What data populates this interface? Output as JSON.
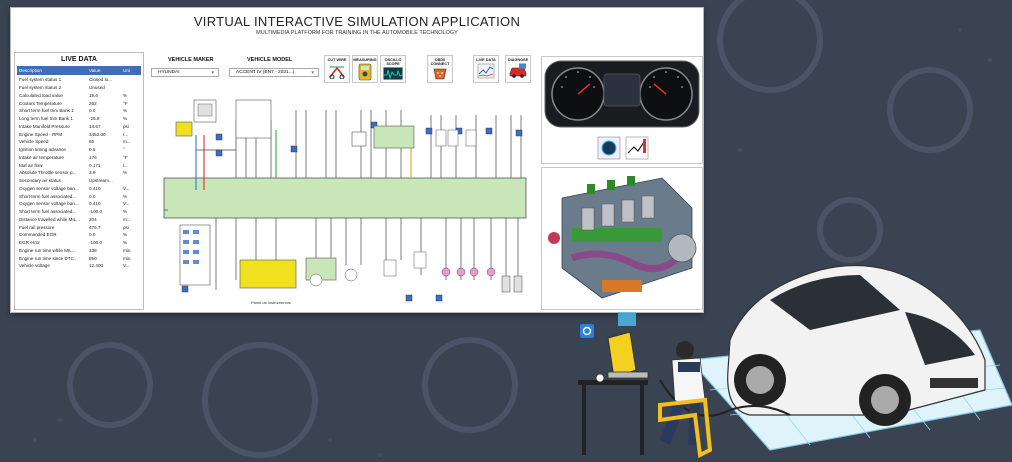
{
  "app": {
    "title": "VIRTUAL INTERACTIVE SIMULATION APPLICATION",
    "subtitle": "MULTIMEDIA PLATFORM FOR TRAINING IN THE AUTOMOBILE TECHNOLOGY"
  },
  "live_data": {
    "title": "LIVE DATA",
    "columns": [
      "Description",
      "Value",
      "Uni"
    ],
    "rows": [
      [
        "Fuel system status 1",
        "Closed lo...",
        ""
      ],
      [
        "Fuel system status 2",
        "Unused",
        ""
      ],
      [
        "Calculated load value",
        "19.6",
        "%"
      ],
      [
        "Coolant Temperature",
        "262",
        "°F"
      ],
      [
        "Short term fuel trim Bank 1",
        "0.0",
        "%"
      ],
      [
        "Long term fuel trim Bank 1",
        "-25.9",
        "%"
      ],
      [
        "Intake Manifold Pressure",
        "14.57",
        "psi"
      ],
      [
        "Engine Speed - RPM",
        "3452.00",
        "r..."
      ],
      [
        "Vehicle Speed",
        "65",
        "m..."
      ],
      [
        "Ignition timing advance",
        "0.5",
        "°"
      ],
      [
        "Intake air temperature",
        "176",
        "°F"
      ],
      [
        "Maf air flow",
        "0.171",
        "l..."
      ],
      [
        "Absolute Throttle sensor p...",
        "3.9",
        "%"
      ],
      [
        "Secondary air status",
        "Upstream...",
        ""
      ],
      [
        "Oxygen sensor voltage ban...",
        "0.410",
        "V..."
      ],
      [
        "Short term fuel associated...",
        "0.0",
        "%"
      ],
      [
        "Oxygen sensor voltage ban...",
        "0.410",
        "V..."
      ],
      [
        "Short term fuel associated...",
        "-100.0",
        "%"
      ],
      [
        "Distance travelled while MIL...",
        "204",
        "m..."
      ],
      [
        "Fuel rail pressure",
        "475.7",
        "psi"
      ],
      [
        "Commanded EGR",
        "0.0",
        "%"
      ],
      [
        "EGR error",
        "-100.0",
        "%"
      ],
      [
        "Engine run time while MIL...",
        "338",
        "min"
      ],
      [
        "Engine run time since DTC...",
        "850",
        "min"
      ],
      [
        "Vehicle voltage",
        "12.400",
        "V..."
      ]
    ]
  },
  "vehicle": {
    "maker_label": "VEHICLE MAKER",
    "maker_value": "HYUNDAI",
    "model_label": "VEHICLE MODEL",
    "model_value": "ACCENT IV (BN7 - 2021...)"
  },
  "tools": [
    {
      "label1": "CUT WIRE",
      "label2": "",
      "icon": "cut-wire-icon"
    },
    {
      "label1": "MEASURING",
      "label2": "",
      "icon": "multimeter-icon"
    },
    {
      "label1": "OSCILLO",
      "label2": "SCOPE",
      "icon": "oscilloscope-icon"
    },
    {
      "label1": "OBDII",
      "label2": "CONNECT",
      "icon": "obd-connect-icon"
    },
    {
      "label1": "LIVE DATA",
      "label2": "",
      "icon": "live-data-icon"
    },
    {
      "label1": "DIAGNOSE",
      "label2": "",
      "icon": "diagnose-car-icon"
    }
  ],
  "diagram": {
    "bottom_label": "Panel de instrumentos"
  },
  "colors": {
    "background": "#3a4352",
    "header_blue": "#3f6fb3",
    "ecu_green": "#c9e6b8",
    "accent_yellow": "#f0e020"
  }
}
